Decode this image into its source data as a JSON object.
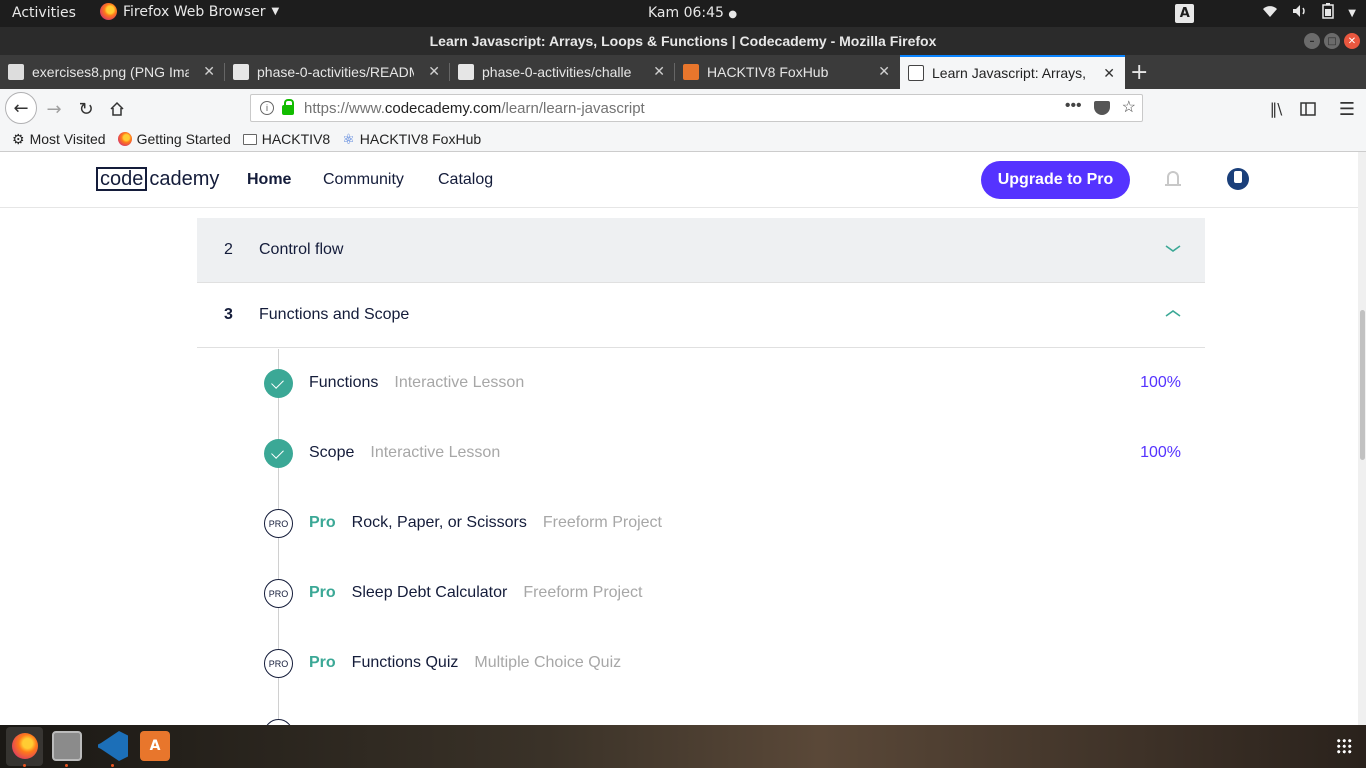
{
  "system_bar": {
    "activities": "Activities",
    "app_menu": "Firefox Web Browser",
    "clock": "Kam 06:45",
    "keyboard_indicator": "A"
  },
  "window": {
    "title": "Learn Javascript: Arrays, Loops & Functions | Codecademy - Mozilla Firefox"
  },
  "tabs": [
    {
      "label": "exercises8.png (PNG Ima",
      "icon": "image-icon",
      "active": false
    },
    {
      "label": "phase-0-activities/READM",
      "icon": "github-icon",
      "active": false
    },
    {
      "label": "phase-0-activities/challe",
      "icon": "github-icon",
      "active": false
    },
    {
      "label": "HACKTIV8 FoxHub",
      "icon": "fox-icon",
      "active": false
    },
    {
      "label": "Learn Javascript: Arrays,",
      "icon": "codecademy-icon",
      "active": true
    }
  ],
  "urlbar": {
    "prefix": "https://www.",
    "domain": "codecademy.com",
    "path": "/learn/learn-javascript"
  },
  "bookmarks": [
    {
      "label": "Most Visited",
      "icon": "gear-icon"
    },
    {
      "label": "Getting Started",
      "icon": "firefox-icon"
    },
    {
      "label": "HACKTIV8",
      "icon": "folder-icon"
    },
    {
      "label": "HACKTIV8 FoxHub",
      "icon": "react-icon"
    }
  ],
  "codecademy_nav": {
    "logo_box": "code",
    "logo_rest": "cademy",
    "links": [
      "Home",
      "Community",
      "Catalog"
    ],
    "active_link": "Home",
    "upgrade_label": "Upgrade to Pro"
  },
  "modules": [
    {
      "number": "2",
      "title": "Control flow",
      "expanded": false
    },
    {
      "number": "3",
      "title": "Functions and Scope",
      "expanded": true
    }
  ],
  "lessons": [
    {
      "name": "Functions",
      "type": "Interactive Lesson",
      "progress": "100%",
      "status": "complete",
      "pro": false
    },
    {
      "name": "Scope",
      "type": "Interactive Lesson",
      "progress": "100%",
      "status": "complete",
      "pro": false
    },
    {
      "pro_label": "Pro",
      "name": "Rock, Paper, or Scissors",
      "type": "Freeform Project",
      "status": "locked",
      "pro": true,
      "marker": "PRO"
    },
    {
      "pro_label": "Pro",
      "name": "Sleep Debt Calculator",
      "type": "Freeform Project",
      "status": "locked",
      "pro": true,
      "marker": "PRO"
    },
    {
      "pro_label": "Pro",
      "name": "Functions Quiz",
      "type": "Multiple Choice Quiz",
      "status": "locked",
      "pro": true,
      "marker": "PRO"
    }
  ],
  "colors": {
    "accent_purple": "#5533ff",
    "complete_teal": "#3ba896",
    "brand_navy": "#141c3a"
  }
}
